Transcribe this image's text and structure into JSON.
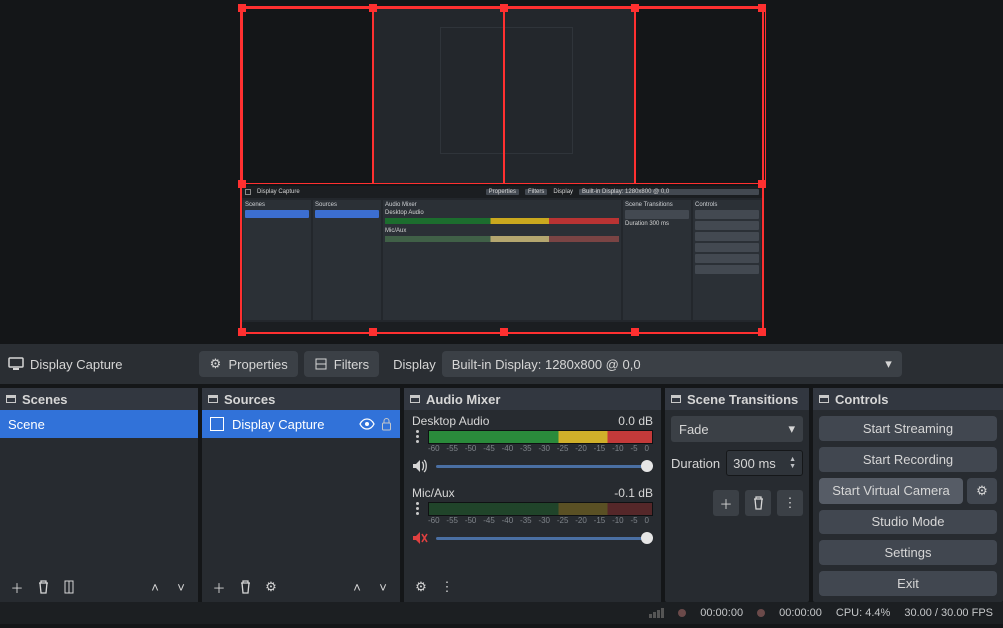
{
  "source_bar": {
    "sel_name_icon": "monitor-icon",
    "sel_name": "Display Capture",
    "props": "Properties",
    "filters": "Filters",
    "disp_label": "Display",
    "disp_value": "Built-in Display: 1280x800 @ 0,0"
  },
  "panels": {
    "scenes": {
      "title": "Scenes",
      "items": [
        "Scene"
      ]
    },
    "sources": {
      "title": "Sources",
      "items": [
        "Display Capture"
      ]
    },
    "mixer": {
      "title": "Audio Mixer",
      "channels": [
        {
          "name": "Desktop Audio",
          "db": "0.0 dB",
          "muted": false
        },
        {
          "name": "Mic/Aux",
          "db": "-0.1 dB",
          "muted": true
        }
      ],
      "tick_labels": [
        "-60",
        "-55",
        "-50",
        "-45",
        "-40",
        "-35",
        "-30",
        "-25",
        "-20",
        "-15",
        "-10",
        "-5",
        "0"
      ]
    },
    "transitions": {
      "title": "Scene Transitions",
      "current": "Fade",
      "duration_label": "Duration",
      "duration_value": "300 ms"
    },
    "controls": {
      "title": "Controls",
      "buttons": {
        "stream": "Start Streaming",
        "record": "Start Recording",
        "vcam": "Start Virtual Camera",
        "studio": "Studio Mode",
        "settings": "Settings",
        "exit": "Exit"
      }
    }
  },
  "status": {
    "time_a": "00:00:00",
    "time_b": "00:00:00",
    "cpu": "CPU: 4.4%",
    "fps": "30.00 / 30.00 FPS"
  }
}
